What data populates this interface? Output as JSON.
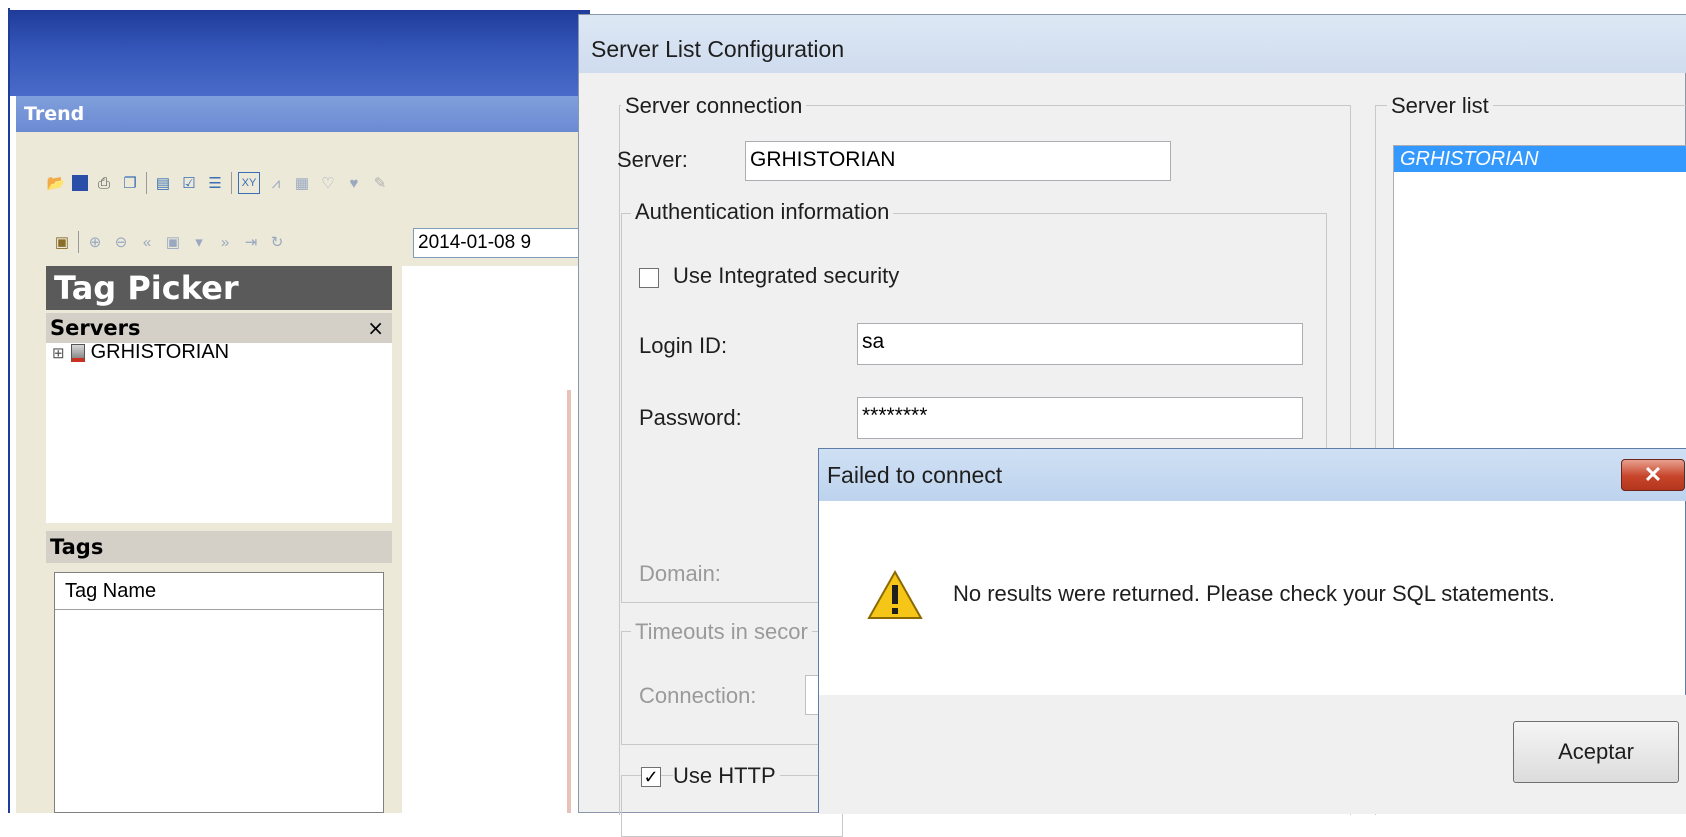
{
  "trend_window": {
    "title": "Trend",
    "date_value": "2014-01-08  9",
    "tag_picker": {
      "title": "Tag Picker",
      "servers_header": "Servers",
      "servers_close": "×",
      "server_node_expander": "⊞",
      "server_node": "GRHISTORIAN",
      "tags_header": "Tags",
      "tag_name_column": "Tag Name"
    }
  },
  "server_list_dialog": {
    "title": "Server List Configuration",
    "server_connection": {
      "legend": "Server connection",
      "server_label": "Server:",
      "server_value": "GRHISTORIAN"
    },
    "authentication": {
      "legend": "Authentication information",
      "integrated_security_label": "Use Integrated security",
      "integrated_security_checked": false,
      "login_label": "Login ID:",
      "login_value": "sa",
      "password_label": "Password:",
      "password_value": "********",
      "domain_label": "Domain:"
    },
    "timeouts": {
      "legend": "Timeouts in secor",
      "connection_label": "Connection:"
    },
    "http": {
      "label": "Use HTTP",
      "checked": true,
      "check_glyph": "✓"
    },
    "server_list": {
      "legend": "Server list",
      "items": [
        "GRHISTORIAN"
      ]
    }
  },
  "failed_dialog": {
    "title": "Failed to connect",
    "close_glyph": "✕",
    "message": "No results were returned.  Please check your SQL statements.",
    "ok_button": "Aceptar"
  },
  "icons": [
    "open-folder-icon",
    "save-icon",
    "print-icon",
    "copy-icon",
    "paste-icon",
    "checkbox-icon",
    "list-icon",
    "xy-chart-icon",
    "trend-chart-icon",
    "grid-chart-icon",
    "heart-icon",
    "add-tag-icon",
    "pen-icon",
    "legend-icon",
    "zoom-in-icon",
    "zoom-out-icon",
    "rewind-icon",
    "play-icon",
    "dropdown-arrow-icon",
    "fast-forward-icon",
    "end-icon",
    "refresh-icon",
    "warning-icon"
  ]
}
